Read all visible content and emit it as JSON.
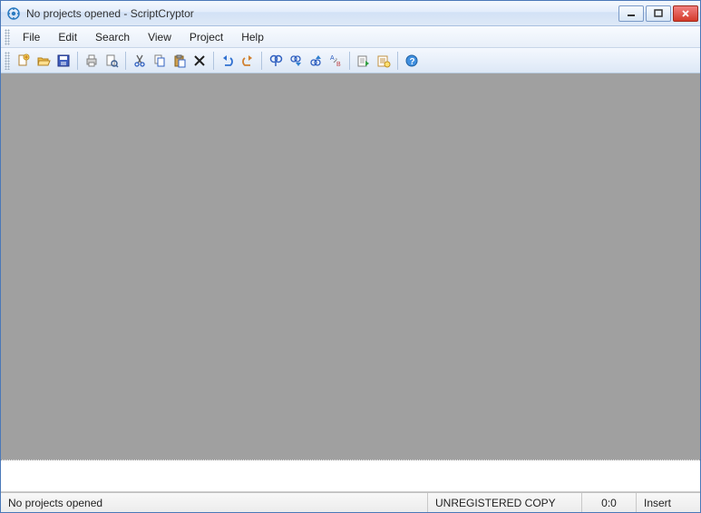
{
  "titlebar": {
    "title": "No projects opened - ScriptCryptor"
  },
  "menubar": {
    "items": [
      "File",
      "Edit",
      "Search",
      "View",
      "Project",
      "Help"
    ]
  },
  "toolbar": {
    "icons": [
      "new-file-icon",
      "open-folder-icon",
      "save-icon",
      "|",
      "print-icon",
      "print-preview-icon",
      "|",
      "cut-icon",
      "copy-icon",
      "paste-icon",
      "delete-icon",
      "|",
      "undo-icon",
      "redo-icon",
      "|",
      "find-icon",
      "find-next-icon",
      "find-prev-icon",
      "bookmark-icon",
      "|",
      "compile-icon",
      "settings-icon",
      "|",
      "help-icon"
    ]
  },
  "statusbar": {
    "message": "No projects opened",
    "registration": "UNREGISTERED COPY",
    "position": "0:0",
    "mode": "Insert"
  }
}
